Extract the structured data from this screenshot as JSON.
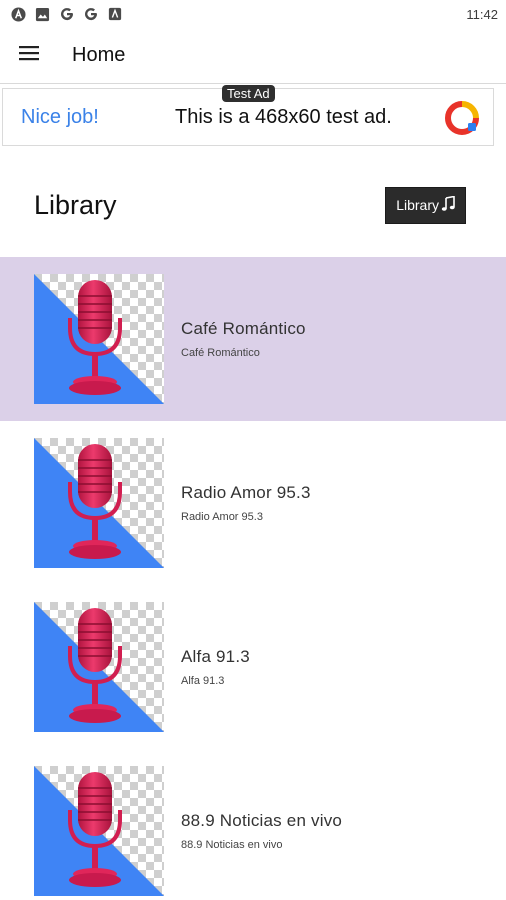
{
  "status_bar": {
    "time": "11:42",
    "icons": [
      "android-auto-icon",
      "image-icon",
      "google-g-icon",
      "google-g-icon",
      "app-icon"
    ]
  },
  "app_bar": {
    "title": "Home",
    "menu_icon": "hamburger-menu-icon"
  },
  "ad": {
    "tag": "Test Ad",
    "left_text": "Nice job!",
    "main_text": "This is a 468x60 test ad.",
    "logo_icon": "ad-logo-icon"
  },
  "library": {
    "title": "Library",
    "button_label": "Library"
  },
  "stations": [
    {
      "name": "Café Romántico",
      "subtitle": "Café Romántico",
      "selected": true
    },
    {
      "name": "Radio Amor 95.3",
      "subtitle": "Radio Amor 95.3",
      "selected": false
    },
    {
      "name": "Alfa 91.3",
      "subtitle": "Alfa 91.3",
      "selected": false
    },
    {
      "name": "88.9 Noticias en vivo",
      "subtitle": "88.9 Noticias en vivo",
      "selected": false
    }
  ],
  "colors": {
    "selected_row": "#dbd0e8",
    "ad_accent": "#3b82e8",
    "thumb_blue": "#3f84f5",
    "mic_pink": "#e0265a"
  }
}
